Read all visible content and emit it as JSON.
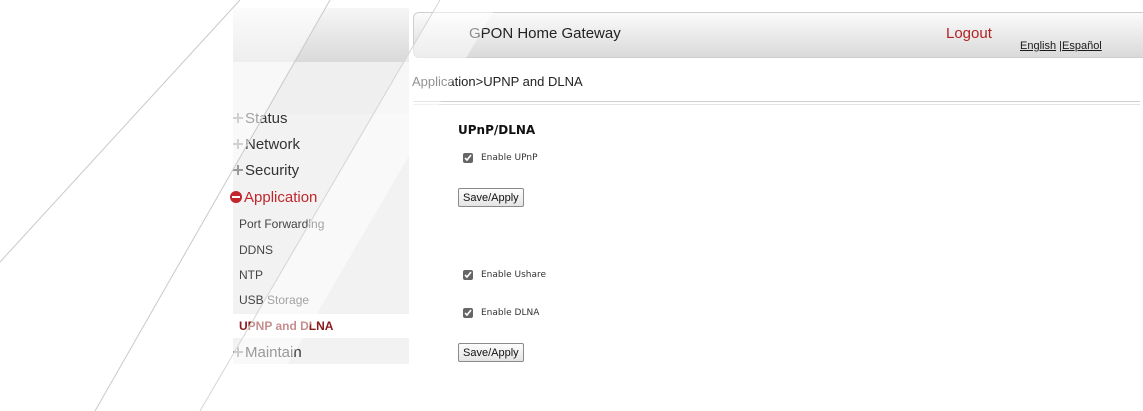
{
  "header": {
    "title": "GPON Home Gateway",
    "logout": "Logout",
    "lang_english": "English",
    "lang_sep": " |",
    "lang_espanol": "Español"
  },
  "breadcrumb": "Application>UPNP and DLNA",
  "sidebar": {
    "items": [
      {
        "label": "Status",
        "type": "main",
        "state": "collapsed"
      },
      {
        "label": "Network",
        "type": "main",
        "state": "collapsed"
      },
      {
        "label": "Security",
        "type": "main",
        "state": "collapsed"
      },
      {
        "label": "Application",
        "type": "main",
        "state": "expanded"
      },
      {
        "label": "Port Forwarding",
        "type": "sub"
      },
      {
        "label": "DDNS",
        "type": "sub"
      },
      {
        "label": "NTP",
        "type": "sub"
      },
      {
        "label": "USB Storage",
        "type": "sub"
      },
      {
        "label": "UPNP and DLNA",
        "type": "sub",
        "selected": true
      },
      {
        "label": "Maintain",
        "type": "main",
        "state": "collapsed"
      }
    ]
  },
  "upnp": {
    "section_title": "UPnP/DLNA",
    "enable_upnp_label": "Enable UPnP",
    "enable_upnp_checked": true,
    "save_label": "Save/Apply"
  },
  "dlna": {
    "enable_ushare_label": "Enable Ushare",
    "enable_ushare_checked": true,
    "enable_dlna_label": "Enable DLNA",
    "enable_dlna_checked": true,
    "save_label": "Save/Apply"
  },
  "colors": {
    "accent_red": "#c0262c",
    "selected_text": "#8b1a1a"
  }
}
